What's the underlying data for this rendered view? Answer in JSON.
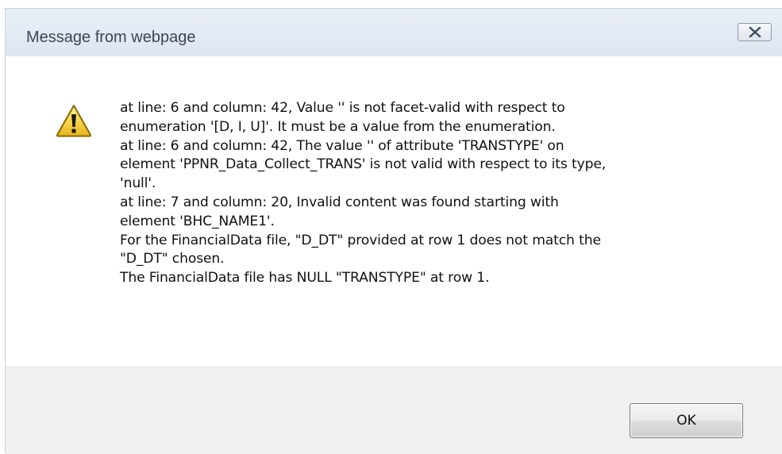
{
  "window": {
    "title": "Message from webpage",
    "close_icon": "close-icon"
  },
  "dialog": {
    "icon": "warning-icon",
    "message_lines": [
      "at line: 6 and column: 42, Value '' is not facet-valid with respect to",
      "enumeration '[D, I, U]'. It must be a value from the enumeration.",
      "at line: 6 and column: 42, The value '' of attribute 'TRANSTYPE' on",
      "element 'PPNR_Data_Collect_TRANS' is not valid with respect to its type,",
      "'null'.",
      "at line: 7 and column: 20, Invalid content was found starting with",
      "element 'BHC_NAME1'.",
      "For the FinancialData file, \"D_DT\" provided at row 1 does not match the",
      "\"D_DT\" chosen.",
      "The FinancialData file has NULL \"TRANSTYPE\" at row 1."
    ],
    "ok_label": "OK"
  },
  "colors": {
    "titlebar": "#dfe8f3",
    "footer": "#f0f0f0",
    "warning_fill": "#f6d548",
    "warning_border": "#8a6a00"
  }
}
